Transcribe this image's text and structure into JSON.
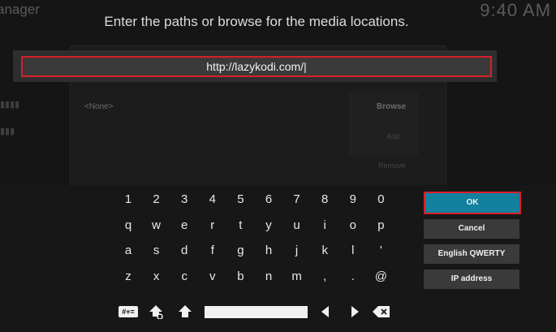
{
  "background": {
    "title_fragment": "anager",
    "clock": "9:40 AM",
    "none_label": "<None>",
    "browse_label": "Browse",
    "add_label": "Add",
    "remove_label": "Remove"
  },
  "dialog": {
    "prompt": "Enter the paths or browse for the media locations.",
    "input_value": "http://lazykodi.com/|"
  },
  "keyboard": {
    "rows": [
      [
        "1",
        "2",
        "3",
        "4",
        "5",
        "6",
        "7",
        "8",
        "9",
        "0"
      ],
      [
        "q",
        "w",
        "e",
        "r",
        "t",
        "y",
        "u",
        "i",
        "o",
        "p"
      ],
      [
        "a",
        "s",
        "d",
        "f",
        "g",
        "h",
        "j",
        "k",
        "l",
        "'"
      ],
      [
        "z",
        "x",
        "c",
        "v",
        "b",
        "n",
        "m",
        ",",
        ".",
        "@"
      ]
    ],
    "symbols_label": "#+=",
    "icons": {
      "symbols": "symbols-icon",
      "shift": "shift-icon",
      "caps": "caps-icon",
      "left": "arrow-left-icon",
      "right": "arrow-right-icon",
      "backspace": "backspace-icon"
    }
  },
  "buttons": {
    "ok": "OK",
    "cancel": "Cancel",
    "layout": "English QWERTY",
    "ip": "IP address"
  },
  "colors": {
    "accent_focus": "#12819e",
    "highlight_border": "#d6202a"
  }
}
